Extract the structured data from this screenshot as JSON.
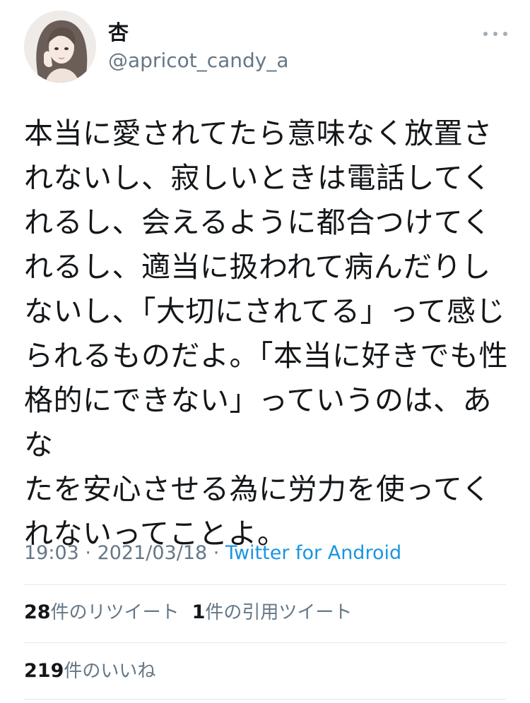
{
  "user": {
    "display_name": "杏",
    "handle": "@apricot_candy_a"
  },
  "tweet": {
    "text": "本当に愛されてたら意味なく放置さ\nれないし、寂しいときは電話してく\nれるし、会えるように都合つけてく\nれるし、適当に扱われて病んだりし\nないし、「大切にされてる」って感じ\nられるものだよ。「本当に好きでも性\n格的にできない」っていうのは、あな\nたを安心させる為に労力を使ってく\nれないってことよ。"
  },
  "meta": {
    "time": "19:03",
    "separator": " · ",
    "date": "2021/03/18",
    "source": "Twitter for Android"
  },
  "stats": {
    "retweets_count": "28",
    "retweets_label": "件のリツイート",
    "quotes_count": "1",
    "quotes_label": "件の引用ツイート",
    "likes_count": "219",
    "likes_label": "件のいいね"
  },
  "colors": {
    "text": "#14171a",
    "secondary": "#657786",
    "link": "#1b95e0",
    "divider": "#e1e8ed"
  },
  "icons": {
    "more": "more-options-icon"
  }
}
